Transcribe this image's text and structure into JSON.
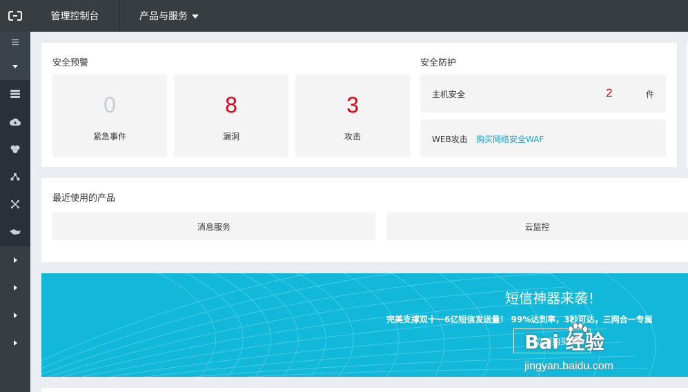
{
  "topbar": {
    "console_label": "管理控制台",
    "products_label": "产品与服务"
  },
  "security_alert": {
    "title": "安全预警",
    "stats": [
      {
        "value": "0",
        "label": "紧急事件",
        "color": "#c8ccd0"
      },
      {
        "value": "8",
        "label": "漏洞",
        "color": "#e60012"
      },
      {
        "value": "3",
        "label": "攻击",
        "color": "#e60012"
      }
    ]
  },
  "security_protection": {
    "title": "安全防护",
    "host": {
      "label": "主机安全",
      "count": "2",
      "unit": "件",
      "count_color": "#e60012"
    },
    "web": {
      "label": "WEB攻击",
      "link": "购买网络安全WAF",
      "link_color": "#1aa3d6"
    }
  },
  "recent_products": {
    "title": "最近使用的产品",
    "items": [
      "消息服务",
      "云监控"
    ]
  },
  "banner": {
    "title": "短信神器来袭！",
    "subtitle": "完美支撑双十一6亿短信发送量！ 99%达到率，3秒可达，三网合一专属",
    "button": "立即购买",
    "bg_color": "#11b8d9"
  },
  "watermark": {
    "brand": "Bai 经验",
    "url": "jingyan.baidu.com"
  },
  "icons": {
    "logo": "aliyun-logo-icon",
    "sidebar": [
      "menu-icon",
      "collapse-icon",
      "server-icon",
      "cloud-icon",
      "puzzle-icon",
      "network-icon",
      "share-icon",
      "truck-icon"
    ]
  }
}
